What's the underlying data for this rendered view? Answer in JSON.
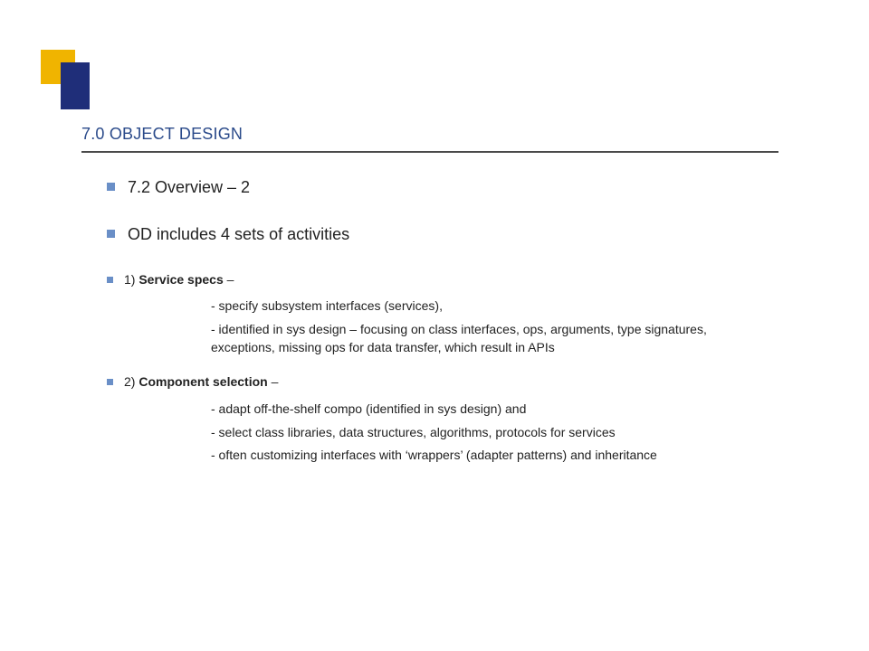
{
  "title": "7.0 OBJECT DESIGN",
  "bullets": {
    "overview": "7.2 Overview – 2",
    "activities": "OD includes 4 sets of activities",
    "item1_prefix": "1) ",
    "item1_bold": "Service specs",
    "item1_suffix": " –",
    "item1_sub1": "- specify subsystem interfaces (services),",
    "item1_sub2": "- identified in sys design – focusing on class interfaces, ops, arguments, type signatures, exceptions, missing ops for data transfer, which result in APIs",
    "item2_prefix": "2) ",
    "item2_bold": "Component selection",
    "item2_suffix": " –",
    "item2_sub1": "- adapt off-the-shelf compo (identified in sys design) and",
    "item2_sub2": "- select class libraries, data structures, algorithms, protocols for services",
    "item2_sub3": "- often customizing interfaces with ‘wrappers’ (adapter patterns) and inheritance"
  }
}
